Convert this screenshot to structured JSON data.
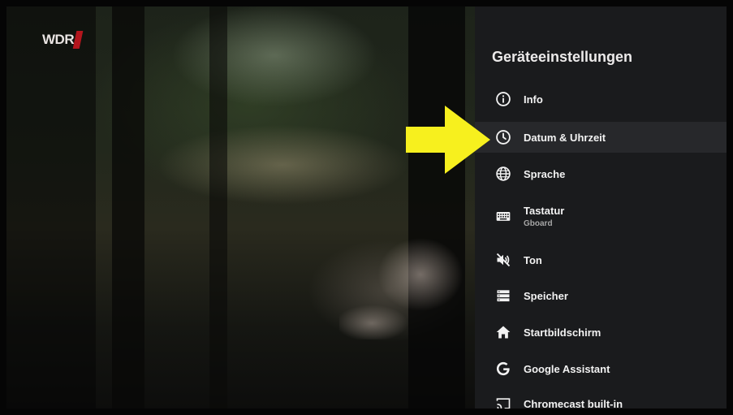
{
  "channel_logo": {
    "text": "WDR"
  },
  "settings_panel": {
    "title": "Geräteeinstellungen",
    "items": [
      {
        "label": "Info",
        "icon": "info-icon"
      },
      {
        "label": "Datum & Uhrzeit",
        "icon": "clock-icon",
        "selected": true
      },
      {
        "label": "Sprache",
        "icon": "globe-icon"
      },
      {
        "label": "Tastatur",
        "sublabel": "Gboard",
        "icon": "keyboard-icon"
      },
      {
        "label": "Ton",
        "icon": "sound-muted-icon"
      },
      {
        "label": "Speicher",
        "icon": "storage-icon"
      },
      {
        "label": "Startbildschirm",
        "icon": "home-icon"
      },
      {
        "label": "Google Assistant",
        "icon": "google-g-icon"
      },
      {
        "label": "Chromecast built-in",
        "icon": "cast-icon"
      }
    ]
  },
  "colors": {
    "panel_bg": "#1a1b1d",
    "selected_bg": "#27282b",
    "arrow": "#f7f01e",
    "logo_mark": "#b3161d"
  }
}
